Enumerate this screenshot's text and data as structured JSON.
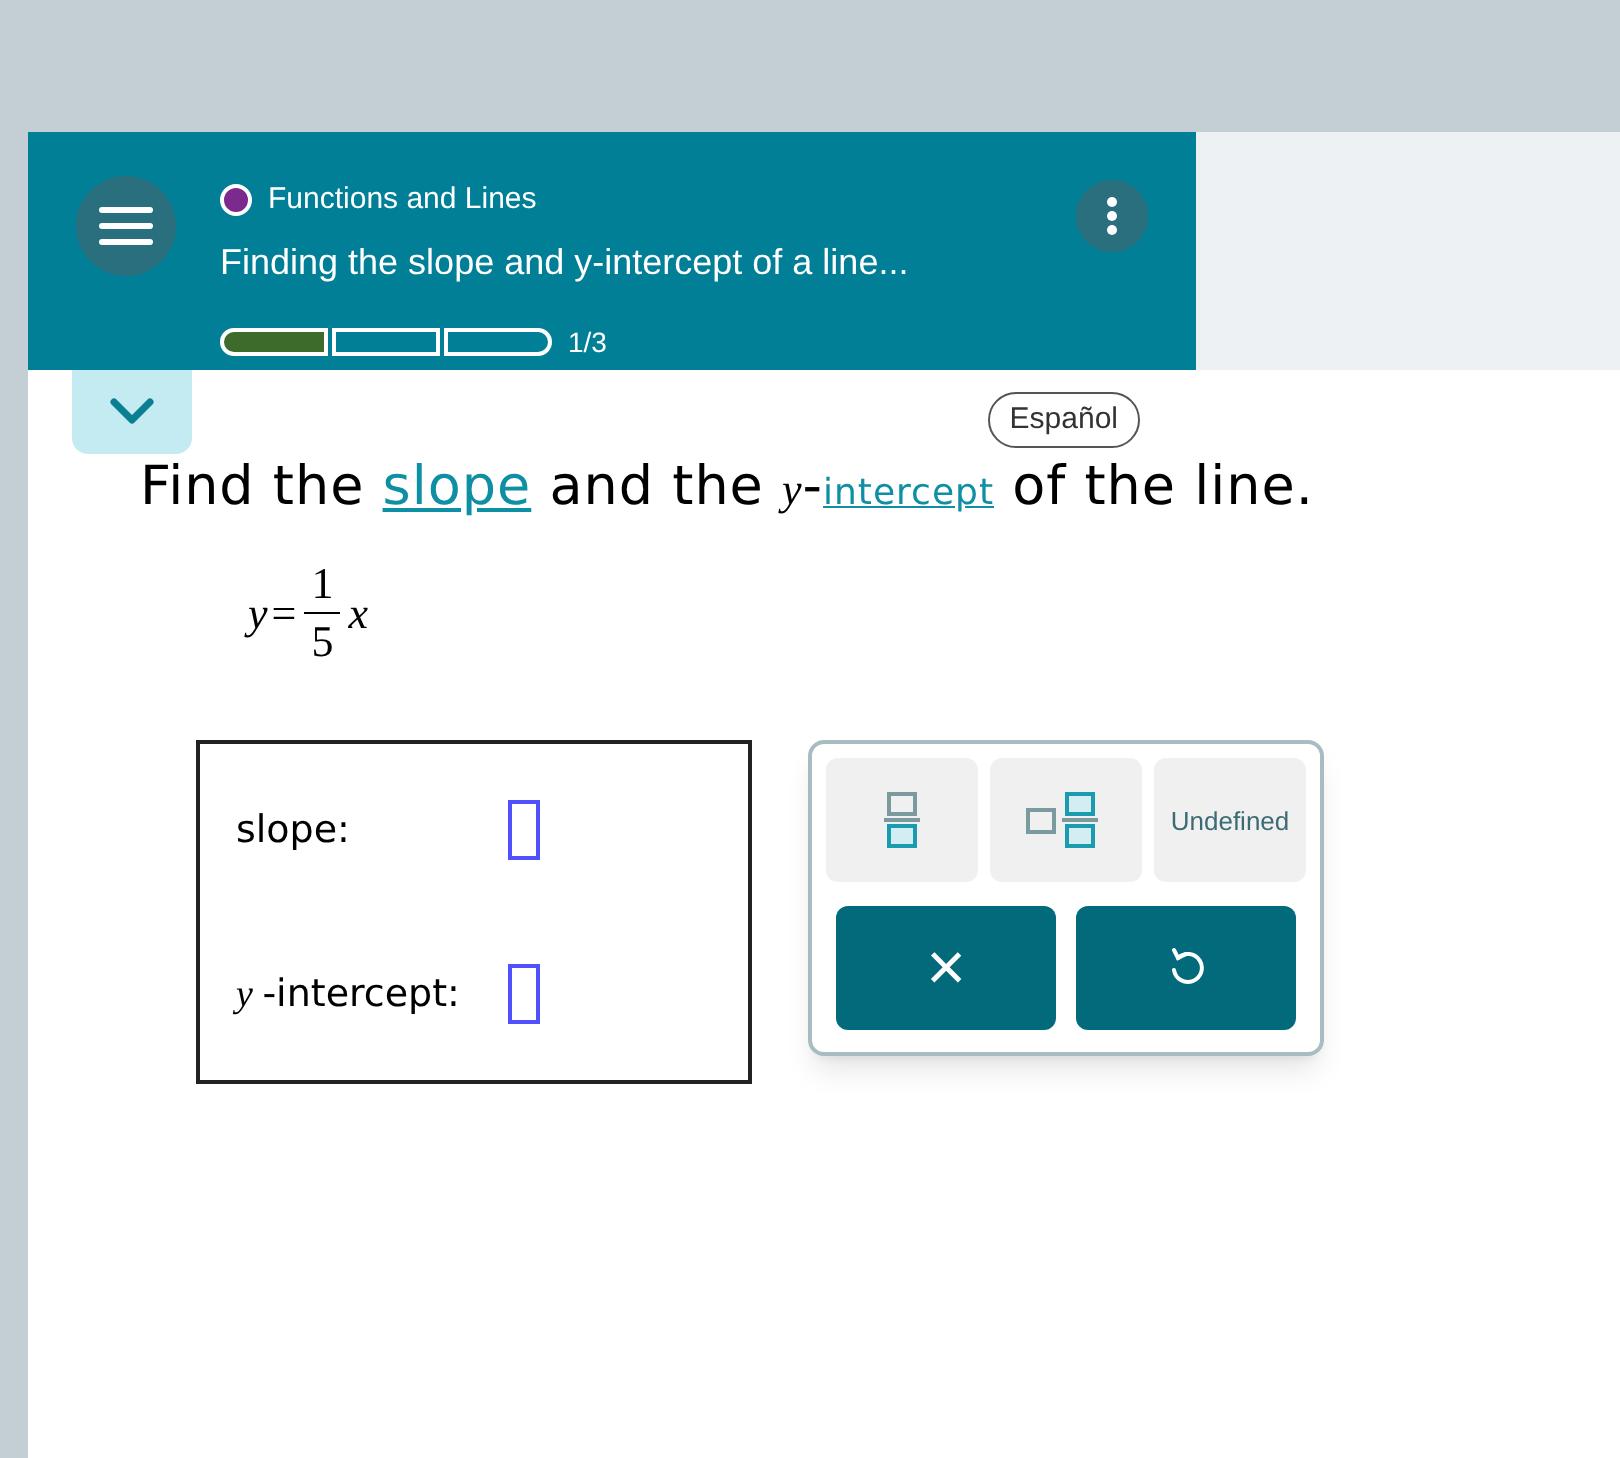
{
  "header": {
    "topic": "Functions and Lines",
    "title": "Finding the slope and y-intercept of a line...",
    "progress": {
      "segments": [
        {
          "filled": true
        },
        {
          "filled": false
        },
        {
          "filled": false
        }
      ],
      "reading": "1/3"
    }
  },
  "language_button": "Español",
  "question": {
    "parts": [
      {
        "kind": "text",
        "text": "Find the "
      },
      {
        "kind": "link",
        "text": "slope"
      },
      {
        "kind": "text",
        "text": " and the "
      },
      {
        "kind": "math",
        "text": "y"
      },
      {
        "kind": "text",
        "text": "-"
      },
      {
        "kind": "smalllink",
        "text": "intercept"
      },
      {
        "kind": "text",
        "text": " of the line."
      }
    ],
    "equation": {
      "lhs": "y",
      "eq": "=",
      "numerator": "1",
      "denominator": "5",
      "var": "x"
    }
  },
  "answers": [
    {
      "label": "slope:"
    },
    {
      "var": "y",
      "label": "-intercept:"
    }
  ],
  "keypad": {
    "keys": [
      {
        "kind": "fraction"
      },
      {
        "kind": "mixed"
      },
      {
        "kind": "text",
        "text": "Undefined"
      }
    ],
    "actions": [
      {
        "kind": "clear",
        "text": "×"
      },
      {
        "kind": "undo"
      }
    ]
  }
}
